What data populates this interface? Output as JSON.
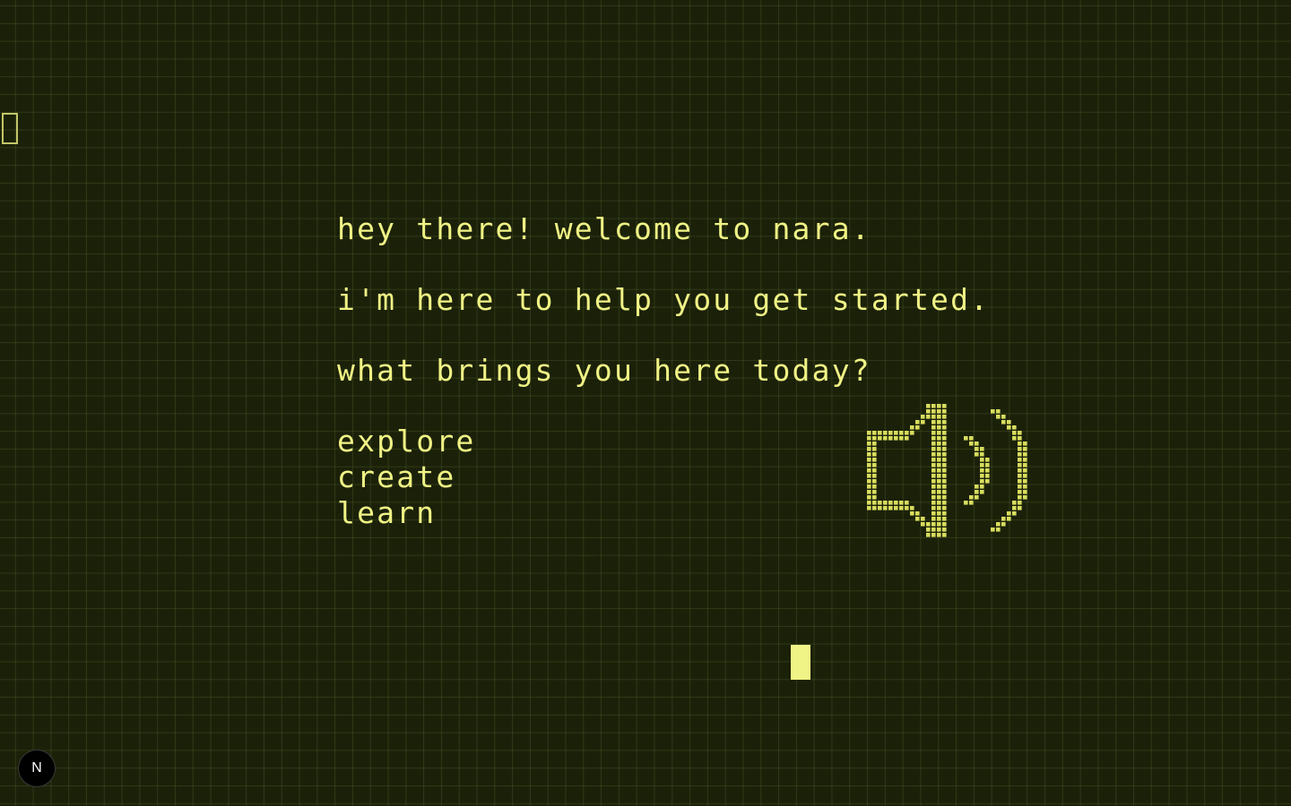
{
  "dialog": {
    "greeting": "hey there! welcome to nara.",
    "intro": "i'm here to help you get started.",
    "question": "what brings you here today?"
  },
  "options": [
    "explore",
    "create",
    "learn"
  ],
  "badge": {
    "label": "N"
  },
  "icons": {
    "speaker": "speaker-volume-icon",
    "badge": "nextjs-logo-icon"
  },
  "colors": {
    "background": "#1b2109",
    "text": "#f0f385",
    "icon": "#d8dd5e",
    "grid": "#3a4321"
  }
}
